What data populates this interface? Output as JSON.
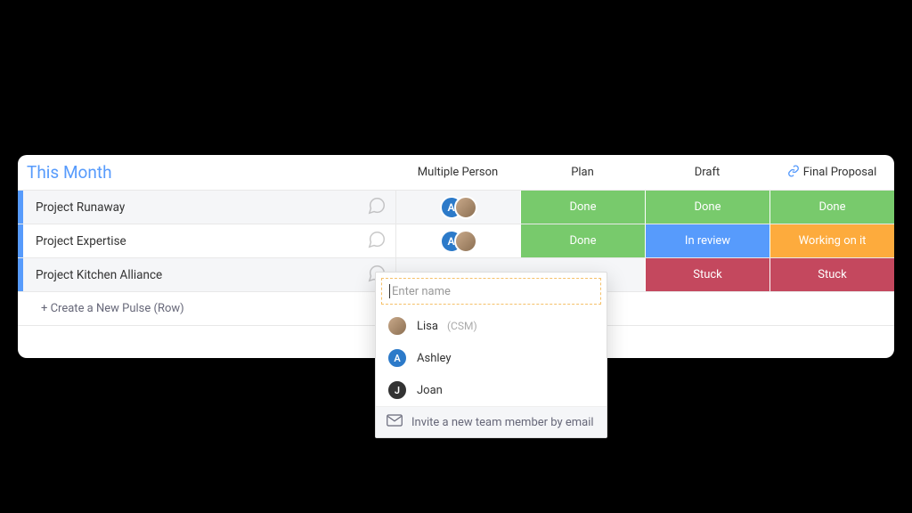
{
  "group": {
    "title": "This Month"
  },
  "columns": {
    "person": "Multiple Person",
    "plan": "Plan",
    "draft": "Draft",
    "final": "Final Proposal"
  },
  "rows": [
    {
      "name": "Project Runaway",
      "persons": [
        {
          "letter": "A",
          "cls": "av-blue"
        },
        {
          "letter": "",
          "cls": "av-photo"
        }
      ],
      "plan": {
        "label": "Done",
        "cls": "status-done"
      },
      "draft": {
        "label": "Done",
        "cls": "status-done"
      },
      "final": {
        "label": "Done",
        "cls": "status-done"
      }
    },
    {
      "name": "Project Expertise",
      "persons": [
        {
          "letter": "A",
          "cls": "av-blue"
        },
        {
          "letter": "",
          "cls": "av-photo"
        }
      ],
      "plan": {
        "label": "Done",
        "cls": "status-done"
      },
      "draft": {
        "label": "In review",
        "cls": "status-review"
      },
      "final": {
        "label": "Working on it",
        "cls": "status-working"
      }
    },
    {
      "name": "Project Kitchen Alliance",
      "persons": [],
      "plan": {
        "label": "",
        "cls": "status-empty",
        "hidden": true
      },
      "draft": {
        "label": "Stuck",
        "cls": "status-stuck"
      },
      "final": {
        "label": "Stuck",
        "cls": "status-stuck"
      }
    }
  ],
  "new_row": {
    "label": "+ Create a New Pulse (Row)"
  },
  "popover": {
    "placeholder": "Enter name",
    "options": [
      {
        "name": "Lisa",
        "meta": "(CSM)",
        "letter": "",
        "cls": "av-photo"
      },
      {
        "name": "Ashley",
        "meta": "",
        "letter": "A",
        "cls": "av-blue"
      },
      {
        "name": "Joan",
        "meta": "",
        "letter": "J",
        "cls": "av-dark"
      }
    ],
    "invite": "Invite a new team member by email"
  }
}
